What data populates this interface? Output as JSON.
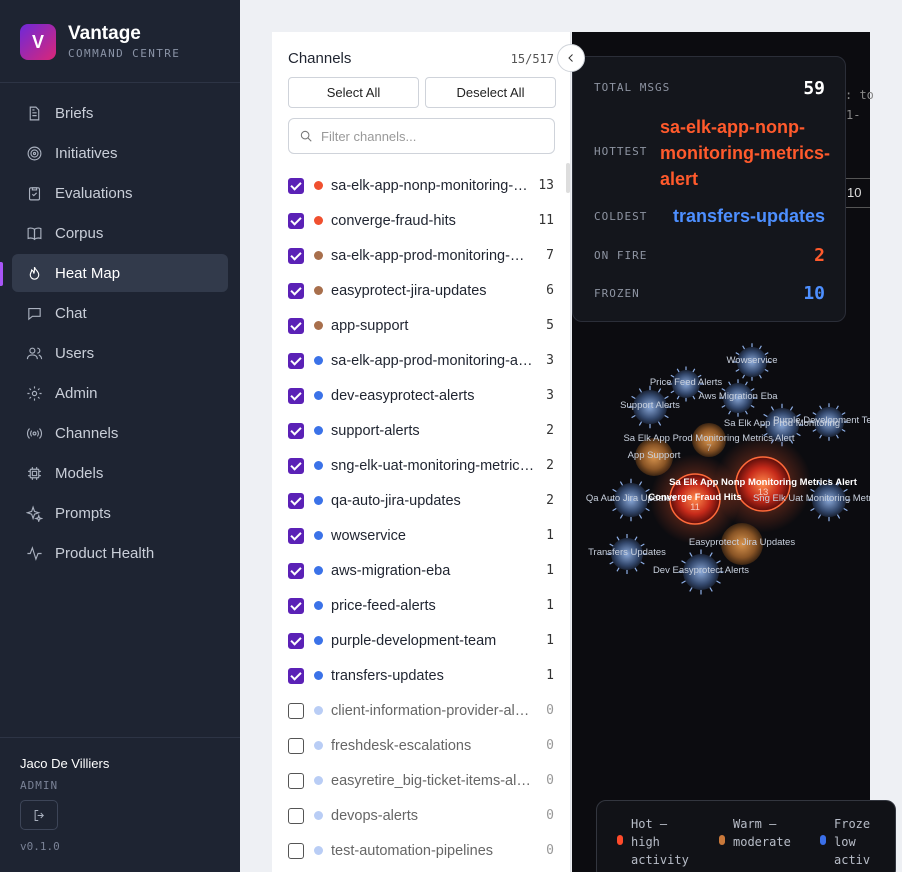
{
  "app": {
    "logo_letter": "V",
    "title": "Vantage",
    "subtitle": "COMMAND CENTRE",
    "version": "v0.1.0"
  },
  "nav": [
    {
      "label": "Briefs",
      "icon": "document-icon"
    },
    {
      "label": "Initiatives",
      "icon": "target-icon"
    },
    {
      "label": "Evaluations",
      "icon": "clipboard-check-icon"
    },
    {
      "label": "Corpus",
      "icon": "book-icon"
    },
    {
      "label": "Heat Map",
      "icon": "flame-icon",
      "active": true
    },
    {
      "label": "Chat",
      "icon": "chat-icon"
    },
    {
      "label": "Users",
      "icon": "users-icon"
    },
    {
      "label": "Admin",
      "icon": "gear-icon"
    },
    {
      "label": "Channels",
      "icon": "broadcast-icon"
    },
    {
      "label": "Models",
      "icon": "chip-icon"
    },
    {
      "label": "Prompts",
      "icon": "sparkles-icon"
    },
    {
      "label": "Product Health",
      "icon": "pulse-icon"
    }
  ],
  "user": {
    "name": "Jaco De Villiers",
    "role": "ADMIN"
  },
  "channels_panel": {
    "title": "Channels",
    "count": "15/517",
    "select_all": "Select All",
    "deselect_all": "Deselect All",
    "filter_placeholder": "Filter channels...",
    "items": [
      {
        "name": "sa-elk-app-nonp-monitoring-metrics-alert",
        "count": "13",
        "checked": true,
        "color": "#f0502f"
      },
      {
        "name": "converge-fraud-hits",
        "count": "11",
        "checked": true,
        "color": "#f0502f"
      },
      {
        "name": "sa-elk-app-prod-monitoring-metrics-alert",
        "count": "7",
        "checked": true,
        "color": "#a86f4c"
      },
      {
        "name": "easyprotect-jira-updates",
        "count": "6",
        "checked": true,
        "color": "#a86f4c"
      },
      {
        "name": "app-support",
        "count": "5",
        "checked": true,
        "color": "#a86f4c"
      },
      {
        "name": "sa-elk-app-prod-monitoring-alerts",
        "count": "3",
        "checked": true,
        "color": "#3b72e8"
      },
      {
        "name": "dev-easyprotect-alerts",
        "count": "3",
        "checked": true,
        "color": "#3b72e8"
      },
      {
        "name": "support-alerts",
        "count": "2",
        "checked": true,
        "color": "#3b72e8"
      },
      {
        "name": "sng-elk-uat-monitoring-metrics-alert",
        "count": "2",
        "checked": true,
        "color": "#3b72e8"
      },
      {
        "name": "qa-auto-jira-updates",
        "count": "2",
        "checked": true,
        "color": "#3b72e8"
      },
      {
        "name": "wowservice",
        "count": "1",
        "checked": true,
        "color": "#3b72e8"
      },
      {
        "name": "aws-migration-eba",
        "count": "1",
        "checked": true,
        "color": "#3b72e8"
      },
      {
        "name": "price-feed-alerts",
        "count": "1",
        "checked": true,
        "color": "#3b72e8"
      },
      {
        "name": "purple-development-team",
        "count": "1",
        "checked": true,
        "color": "#3b72e8"
      },
      {
        "name": "transfers-updates",
        "count": "1",
        "checked": true,
        "color": "#3b72e8"
      },
      {
        "name": "client-information-provider-alerts",
        "count": "0",
        "checked": false,
        "color": "#b9cdf5"
      },
      {
        "name": "freshdesk-escalations",
        "count": "0",
        "checked": false,
        "color": "#b9cdf5"
      },
      {
        "name": "easyretire_big-ticket-items-alerts",
        "count": "0",
        "checked": false,
        "color": "#b9cdf5"
      },
      {
        "name": "devops-alerts",
        "count": "0",
        "checked": false,
        "color": "#b9cdf5"
      },
      {
        "name": "test-automation-pipelines",
        "count": "0",
        "checked": false,
        "color": "#b9cdf5"
      }
    ]
  },
  "stats": {
    "total_label": "TOTAL MSGS",
    "total_value": "59",
    "hottest_label": "HOTTEST",
    "hottest_value": "sa-elk-app-nonp-monitoring-metrics-alert",
    "coldest_label": "COLDEST",
    "coldest_value": "transfers-updates",
    "onfire_label": "ON FIRE",
    "onfire_value": "2",
    "frozen_label": "FROZEN",
    "frozen_value": "10"
  },
  "background_fragments": {
    "line1": ": to",
    "line2": "1-",
    "date_fragment": "10"
  },
  "bubbles": [
    {
      "name": "Wowservice",
      "temp": "frozen",
      "count": ""
    },
    {
      "name": "Price Feed Alerts",
      "temp": "frozen",
      "count": ""
    },
    {
      "name": "Aws Migration Eba",
      "temp": "frozen",
      "count": ""
    },
    {
      "name": "Support Alerts",
      "temp": "frozen",
      "count": ""
    },
    {
      "name": "Sa Elk App Prod Monitoring Metrics Alert",
      "temp": "warm",
      "count": "7"
    },
    {
      "name": "Sa Elk App Prod Monitoring",
      "temp": "frozen",
      "count": ""
    },
    {
      "name": "Purple Development Team",
      "temp": "frozen",
      "count": ""
    },
    {
      "name": "App Support",
      "temp": "warm",
      "count": ""
    },
    {
      "name": "Sa Elk App Nonp Monitoring Metrics Alert",
      "temp": "hot",
      "count": "13"
    },
    {
      "name": "Qa Auto Jira Updates",
      "temp": "frozen",
      "count": ""
    },
    {
      "name": "Converge Fraud Hits",
      "temp": "hot",
      "count": "11"
    },
    {
      "name": "Sng Elk Uat Monitoring Metrics Alert",
      "temp": "frozen",
      "count": ""
    },
    {
      "name": "Easyprotect Jira Updates",
      "temp": "warm",
      "count": ""
    },
    {
      "name": "Transfers Updates",
      "temp": "frozen",
      "count": ""
    },
    {
      "name": "Dev Easyprotect Alerts",
      "temp": "frozen",
      "count": ""
    }
  ],
  "legend": [
    {
      "line1": "Hot —",
      "line2": "high",
      "line3": "activity",
      "color": "#ff4a2a"
    },
    {
      "line1": "Warm —",
      "line2": "moderate",
      "line3": "",
      "color": "#c9783a"
    },
    {
      "line1": "Froze",
      "line2": "low",
      "line3": "activ",
      "color": "#3b6fe8"
    }
  ]
}
